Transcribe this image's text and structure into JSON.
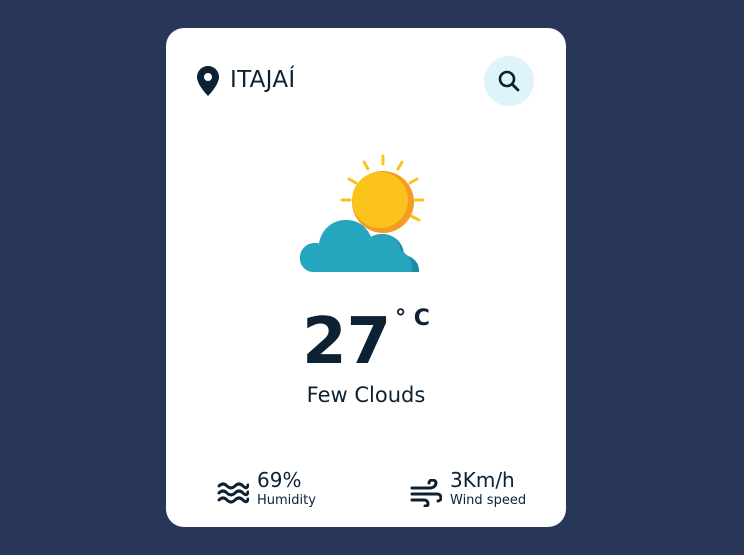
{
  "location": {
    "icon": "map-pin-icon",
    "city": "ITAJAÍ"
  },
  "search": {
    "icon": "search-icon"
  },
  "weather": {
    "icon": "sun-behind-cloud-icon",
    "temperature": "27",
    "unit": "° C",
    "condition": "Few Clouds"
  },
  "details": {
    "humidity": {
      "icon": "waves-icon",
      "value": "69%",
      "label": "Humidity"
    },
    "wind": {
      "icon": "wind-icon",
      "value": "3Km/h",
      "label": "Wind speed"
    }
  },
  "colors": {
    "background": "#283759",
    "card": "#ffffff",
    "text": "#0d2134",
    "search_bg": "#dff3fb",
    "sun": "#fdc31d",
    "cloud": "#26a5bf"
  }
}
